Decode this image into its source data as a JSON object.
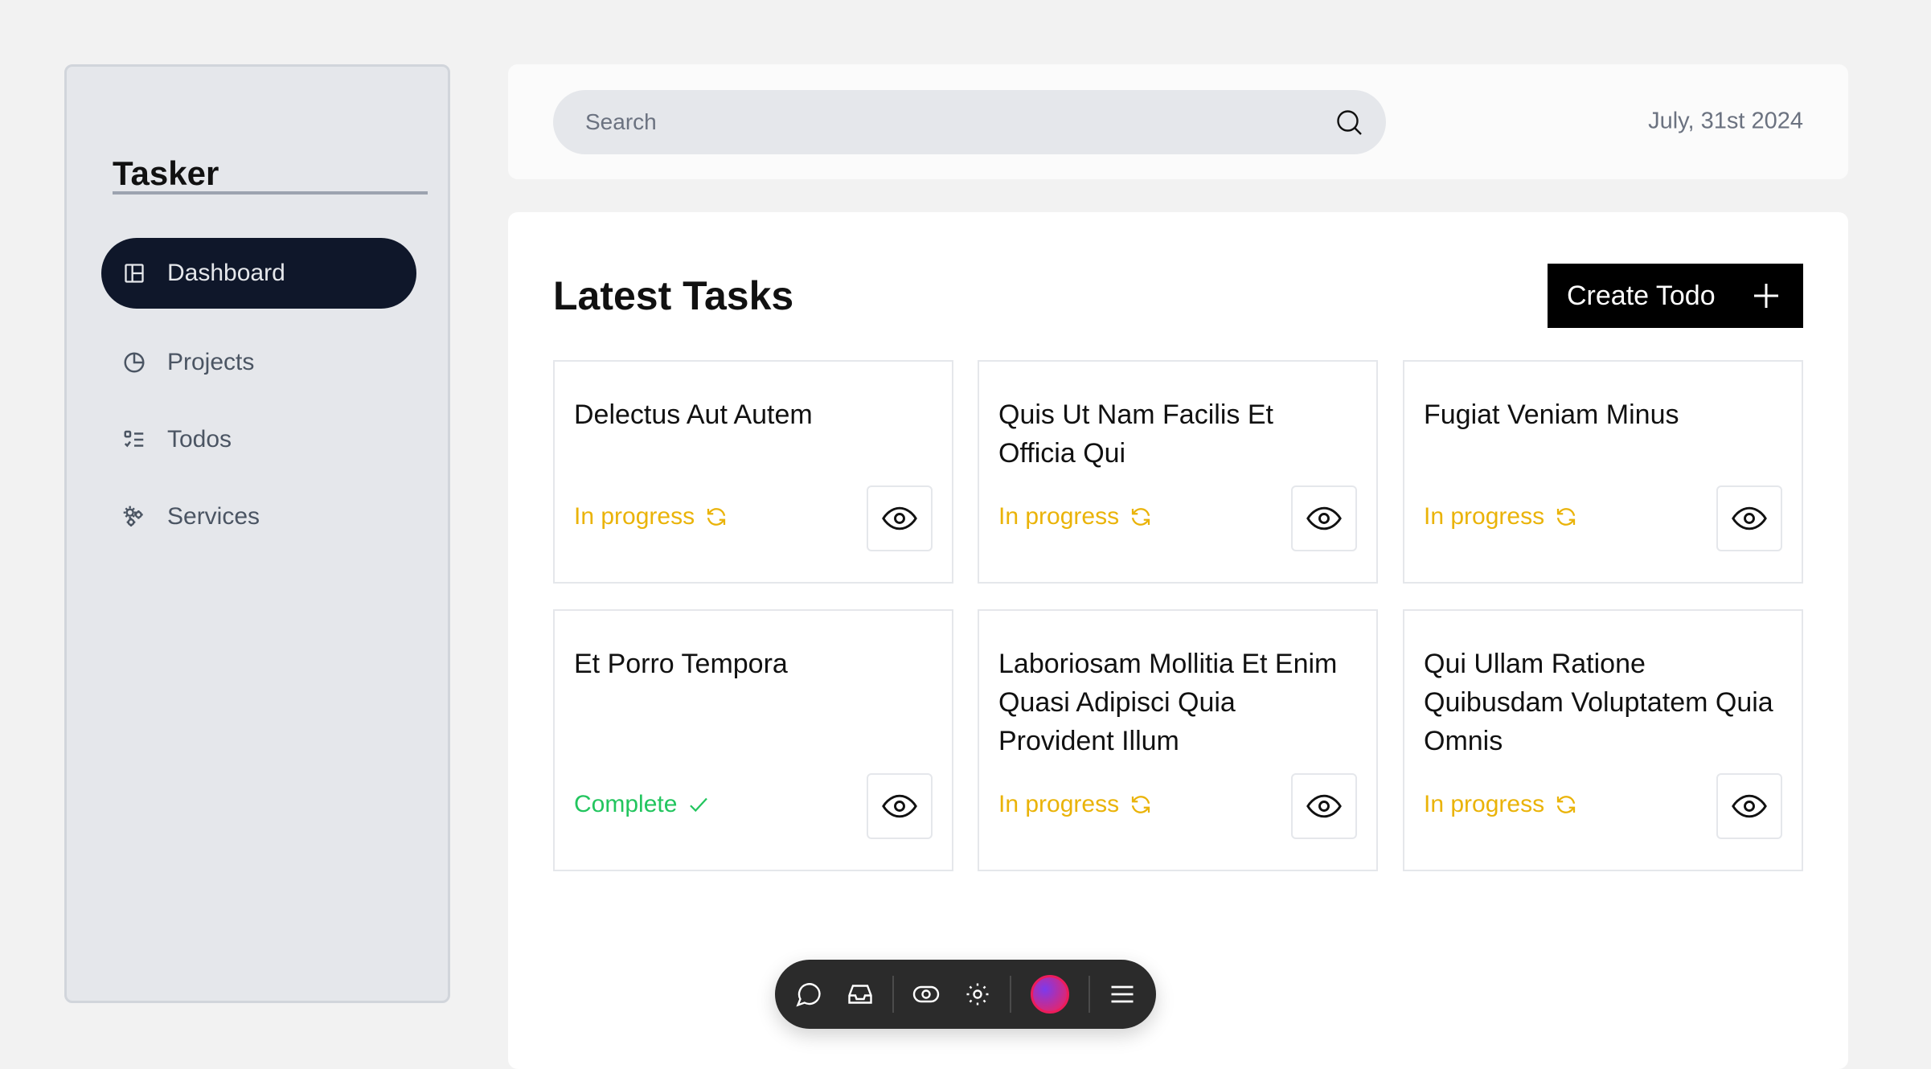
{
  "app": {
    "name": "Tasker"
  },
  "sidebar": {
    "items": [
      {
        "label": "Dashboard",
        "icon": "layout-icon",
        "active": true
      },
      {
        "label": "Projects",
        "icon": "pie-chart-icon",
        "active": false
      },
      {
        "label": "Todos",
        "icon": "list-todo-icon",
        "active": false
      },
      {
        "label": "Services",
        "icon": "gears-icon",
        "active": false
      }
    ]
  },
  "header": {
    "search_placeholder": "Search",
    "date": "July, 31st 2024"
  },
  "main": {
    "title": "Latest Tasks",
    "create_label": "Create Todo",
    "tasks": [
      {
        "title": "Delectus Aut Autem",
        "status": "In progress"
      },
      {
        "title": "Quis Ut Nam Facilis Et Officia Qui",
        "status": "In progress"
      },
      {
        "title": "Fugiat Veniam Minus",
        "status": "In progress"
      },
      {
        "title": "Et Porro Tempora",
        "status": "Complete"
      },
      {
        "title": "Laboriosam Mollitia Et Enim Quasi Adipisci Quia Provident Illum",
        "status": "In progress"
      },
      {
        "title": "Qui Ullam Ratione Quibusdam Voluptatem Quia Omnis",
        "status": "In progress"
      }
    ]
  },
  "dock": {
    "icons": [
      "comment-icon",
      "inbox-icon",
      "eye-toggle-icon",
      "focus-icon",
      "avatar",
      "menu-icon"
    ]
  },
  "colors": {
    "accent_dark": "#0f172a",
    "in_progress": "#eab308",
    "complete": "#22c55e",
    "button_bg": "#000000"
  }
}
